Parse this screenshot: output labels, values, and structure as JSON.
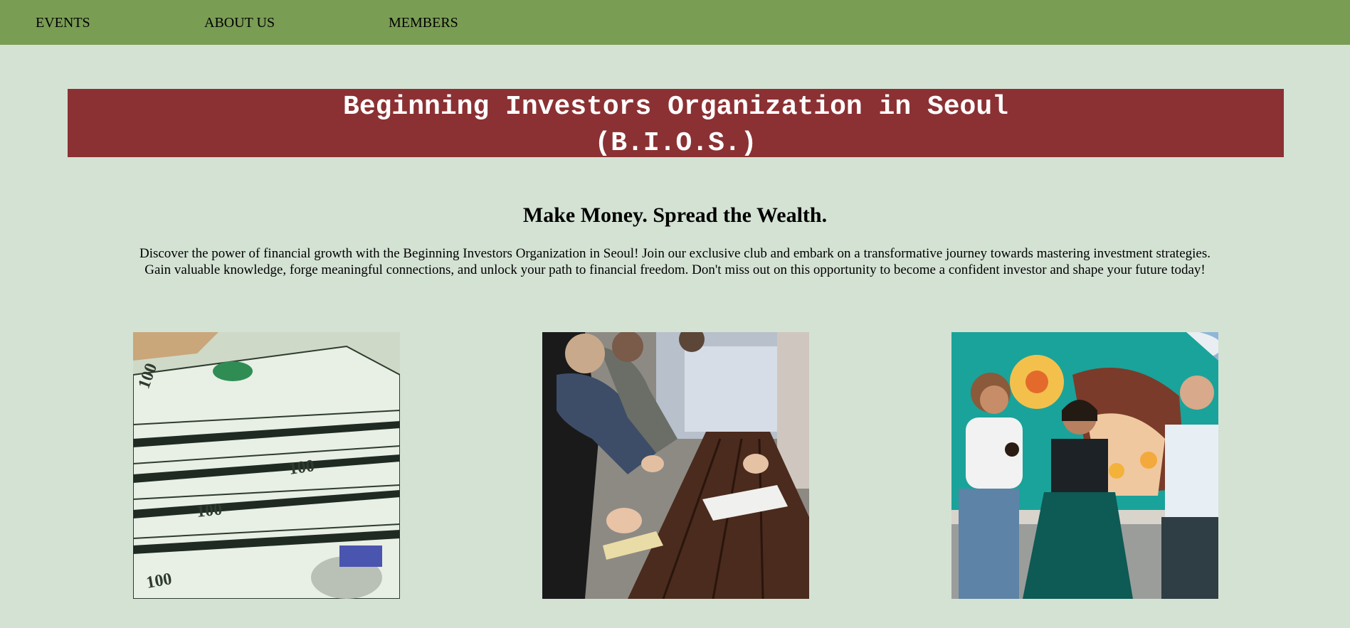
{
  "nav": {
    "items": [
      {
        "label": "EVENTS"
      },
      {
        "label": "ABOUT US"
      },
      {
        "label": "MEMBERS"
      }
    ]
  },
  "banner": {
    "line1": "Beginning Investors Organization in Seoul",
    "line2": "(B.I.O.S.)"
  },
  "tagline": "Make Money. Spread the Wealth.",
  "intro": "Discover the power of financial growth with the Beginning Investors Organization in Seoul! Join our exclusive club and embark on a transformative journey towards mastering investment strategies. Gain valuable knowledge, forge meaningful connections, and unlock your path to financial freedom. Don't miss out on this opportunity to become a confident investor and shape your future today!",
  "photos": [
    {
      "icon": "money-photo"
    },
    {
      "icon": "meeting-photo"
    },
    {
      "icon": "friends-mural-photo"
    }
  ],
  "colors": {
    "navbar": "#7a9d54",
    "background": "#d4e2d4",
    "banner": "#8b3133",
    "banner_text": "#ffffff"
  }
}
